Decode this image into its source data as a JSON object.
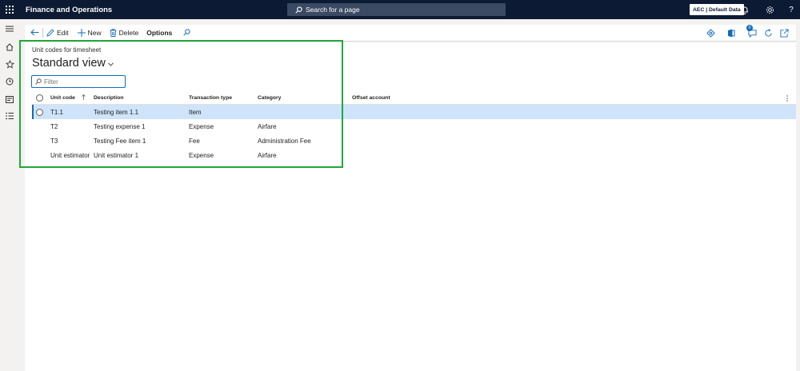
{
  "topbar": {
    "app_title": "Finance and Operations",
    "search_placeholder": "Search for a page",
    "company": "AEC | Default Data",
    "icons": [
      "waffle-icon",
      "search-icon",
      "bell-icon",
      "gear-icon",
      "help-icon"
    ]
  },
  "colors": {
    "topbar_bg": "#0c1b33",
    "accent": "#0f6cbd",
    "selected_row": "#cfe4fa",
    "highlight": "#22a73b"
  },
  "navpane": {
    "icons": [
      "hamburger-icon",
      "home-icon",
      "star-icon",
      "clock-icon",
      "workspace-icon",
      "list-icon"
    ]
  },
  "actionpane": {
    "edit": "Edit",
    "new": "New",
    "delete": "Delete",
    "options": "Options",
    "notification_count": "0"
  },
  "page": {
    "caption": "Unit codes for timesheet",
    "view_title": "Standard view",
    "filter_placeholder": "Filter"
  },
  "grid": {
    "columns": [
      "Unit code",
      "Description",
      "Transaction type",
      "Category",
      "Offset account"
    ],
    "rows": [
      {
        "unit_code": "T1.1",
        "description": "Testing item 1.1",
        "transaction_type": "Item",
        "category": "",
        "offset_account": "",
        "selected": true
      },
      {
        "unit_code": "T2",
        "description": "Testing expense 1",
        "transaction_type": "Expense",
        "category": "Airfare",
        "offset_account": ""
      },
      {
        "unit_code": "T3",
        "description": "Testing Fee item 1",
        "transaction_type": "Fee",
        "category": "Administration Fee",
        "offset_account": ""
      },
      {
        "unit_code": "Unit estimator",
        "description": "Unit estimator 1",
        "transaction_type": "Expense",
        "category": "Airfare",
        "offset_account": ""
      }
    ]
  }
}
